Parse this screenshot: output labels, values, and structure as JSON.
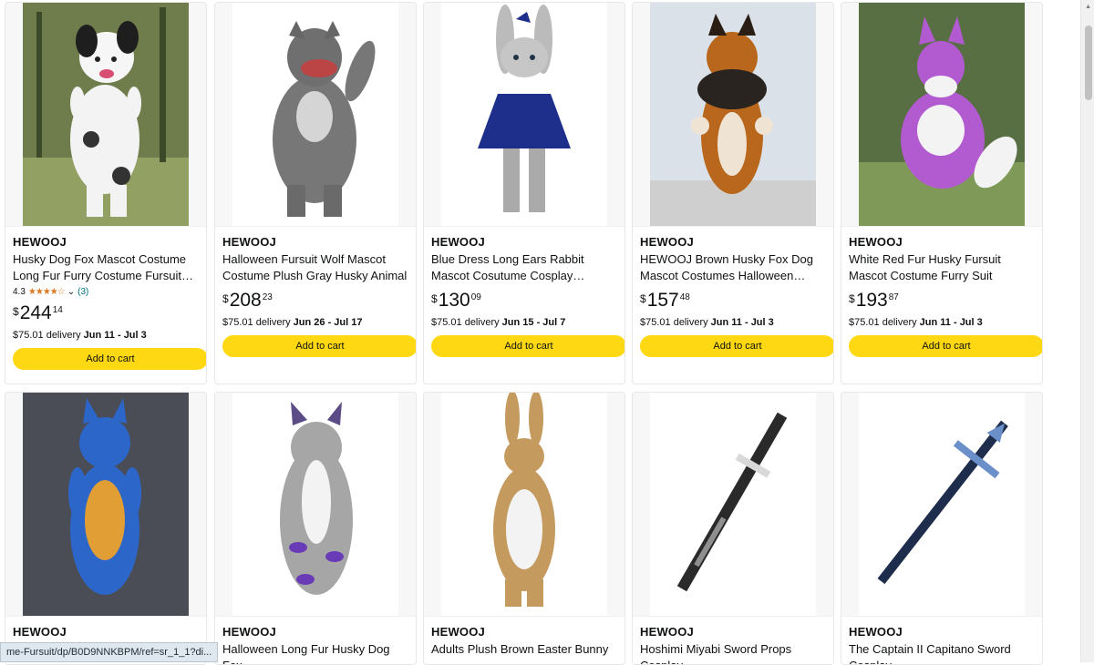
{
  "status_url": "me-Fursuit/dp/B0D9NNKBPM/ref=sr_1_1?di...",
  "colors": {
    "accent": "#ffd814",
    "stars": "#de7921",
    "link": "#007185"
  },
  "products": [
    {
      "brand": "HEWOOJ",
      "title": "Husky Dog Fox Mascot Costume Long Fur Furry Costume Fursuit Wolf Whit...",
      "rating_value": "4.3",
      "rating_count": "(3)",
      "price_currency": "$",
      "price_whole": "244",
      "price_fraction": "14",
      "delivery_price": "$75.01 delivery ",
      "delivery_dates": "Jun 11 - Jul 3",
      "button": "Add to cart"
    },
    {
      "brand": "HEWOOJ",
      "title": "Halloween Fursuit Wolf Mascot Costume Plush Gray Husky Animal",
      "price_currency": "$",
      "price_whole": "208",
      "price_fraction": "23",
      "delivery_price": "$75.01 delivery ",
      "delivery_dates": "Jun 26 - Jul 17",
      "button": "Add to cart"
    },
    {
      "brand": "HEWOOJ",
      "title": "Blue Dress Long Ears Rabbit Mascot Cosutume Cosplay Christmas Outfits",
      "price_currency": "$",
      "price_whole": "130",
      "price_fraction": "09",
      "delivery_price": "$75.01 delivery ",
      "delivery_dates": "Jun 15 - Jul 7",
      "button": "Add to cart"
    },
    {
      "brand": "HEWOOJ",
      "title": "HEWOOJ Brown Husky Fox Dog Mascot Costumes Halloween…",
      "price_currency": "$",
      "price_whole": "157",
      "price_fraction": "48",
      "delivery_price": "$75.01 delivery ",
      "delivery_dates": "Jun 11 - Jul 3",
      "button": "Add to cart"
    },
    {
      "brand": "HEWOOJ",
      "title": "White Red Fur Husky Fursuit Mascot Costume Furry Suit",
      "price_currency": "$",
      "price_whole": "193",
      "price_fraction": "87",
      "delivery_price": "$75.01 delivery ",
      "delivery_dates": "Jun 11 - Jul 3",
      "button": "Add to cart"
    },
    {
      "brand": "HEWOOJ",
      "title": ""
    },
    {
      "brand": "HEWOOJ",
      "title": "Halloween Long Fur Husky Dog Fox"
    },
    {
      "brand": "HEWOOJ",
      "title": "Adults Plush Brown Easter Bunny"
    },
    {
      "brand": "HEWOOJ",
      "title": "Hoshimi Miyabi Sword Props Cosplay"
    },
    {
      "brand": "HEWOOJ",
      "title": "The Captain II Capitano Sword Cosplay"
    }
  ]
}
